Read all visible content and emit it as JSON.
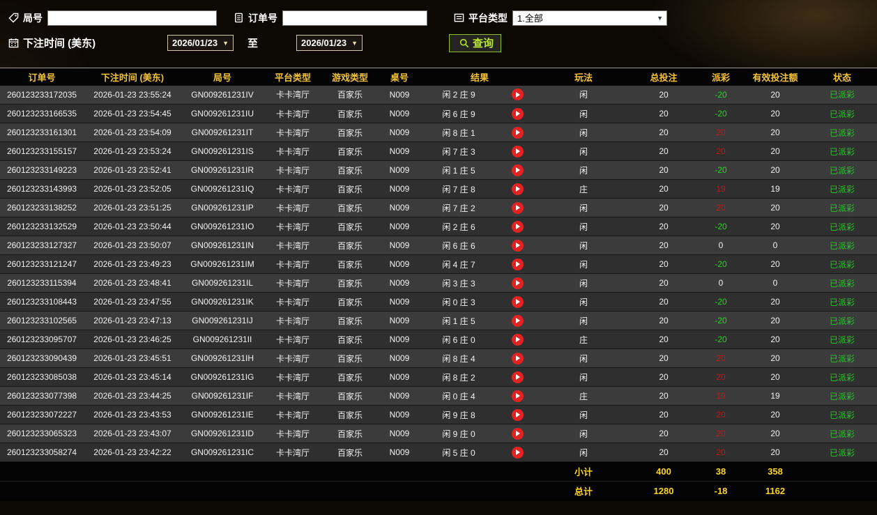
{
  "toolbar": {
    "round_label": "局号",
    "round_value": "",
    "order_label": "订单号",
    "order_value": "",
    "platform_label": "平台类型",
    "platform_value": "1.全部",
    "bet_time_label": "下注时间 (美东)",
    "date_from": "2026/01/23",
    "to_label": "至",
    "date_to": "2026/01/23",
    "query_label": "查询"
  },
  "colors": {
    "header_text": "#f2c23a",
    "win_red": "#c01818",
    "loss_green": "#27d527",
    "status_green": "#2fc32f",
    "footer_yellow": "#ffd41c",
    "query_accent": "#b9e62e",
    "play_button_red": "#e32222"
  },
  "table": {
    "headers": [
      "订单号",
      "下注时间 (美东)",
      "局号",
      "平台类型",
      "游戏类型",
      "桌号",
      "结果",
      "玩法",
      "总投注",
      "派彩",
      "有效投注额",
      "状态"
    ],
    "rows": [
      {
        "order_id": "260123233172035",
        "bet_time": "2026-01-23 23:55:24",
        "round_id": "GN009261231IV",
        "platform": "卡卡湾厅",
        "game_type": "百家乐",
        "table_no": "N009",
        "result": "闲 2 庄 9",
        "play_type": "闲",
        "total_bet": "20",
        "payout": "-20",
        "valid_bet": "20",
        "status": "已派彩"
      },
      {
        "order_id": "260123233166535",
        "bet_time": "2026-01-23 23:54:45",
        "round_id": "GN009261231IU",
        "platform": "卡卡湾厅",
        "game_type": "百家乐",
        "table_no": "N009",
        "result": "闲 6 庄 9",
        "play_type": "闲",
        "total_bet": "20",
        "payout": "-20",
        "valid_bet": "20",
        "status": "已派彩"
      },
      {
        "order_id": "260123233161301",
        "bet_time": "2026-01-23 23:54:09",
        "round_id": "GN009261231IT",
        "platform": "卡卡湾厅",
        "game_type": "百家乐",
        "table_no": "N009",
        "result": "闲 8 庄 1",
        "play_type": "闲",
        "total_bet": "20",
        "payout": "20",
        "valid_bet": "20",
        "status": "已派彩"
      },
      {
        "order_id": "260123233155157",
        "bet_time": "2026-01-23 23:53:24",
        "round_id": "GN009261231IS",
        "platform": "卡卡湾厅",
        "game_type": "百家乐",
        "table_no": "N009",
        "result": "闲 7 庄 3",
        "play_type": "闲",
        "total_bet": "20",
        "payout": "20",
        "valid_bet": "20",
        "status": "已派彩"
      },
      {
        "order_id": "260123233149223",
        "bet_time": "2026-01-23 23:52:41",
        "round_id": "GN009261231IR",
        "platform": "卡卡湾厅",
        "game_type": "百家乐",
        "table_no": "N009",
        "result": "闲 1 庄 5",
        "play_type": "闲",
        "total_bet": "20",
        "payout": "-20",
        "valid_bet": "20",
        "status": "已派彩"
      },
      {
        "order_id": "260123233143993",
        "bet_time": "2026-01-23 23:52:05",
        "round_id": "GN009261231IQ",
        "platform": "卡卡湾厅",
        "game_type": "百家乐",
        "table_no": "N009",
        "result": "闲 7 庄 8",
        "play_type": "庄",
        "total_bet": "20",
        "payout": "19",
        "valid_bet": "19",
        "status": "已派彩"
      },
      {
        "order_id": "260123233138252",
        "bet_time": "2026-01-23 23:51:25",
        "round_id": "GN009261231IP",
        "platform": "卡卡湾厅",
        "game_type": "百家乐",
        "table_no": "N009",
        "result": "闲 7 庄 2",
        "play_type": "闲",
        "total_bet": "20",
        "payout": "20",
        "valid_bet": "20",
        "status": "已派彩"
      },
      {
        "order_id": "260123233132529",
        "bet_time": "2026-01-23 23:50:44",
        "round_id": "GN009261231IO",
        "platform": "卡卡湾厅",
        "game_type": "百家乐",
        "table_no": "N009",
        "result": "闲 2 庄 6",
        "play_type": "闲",
        "total_bet": "20",
        "payout": "-20",
        "valid_bet": "20",
        "status": "已派彩"
      },
      {
        "order_id": "260123233127327",
        "bet_time": "2026-01-23 23:50:07",
        "round_id": "GN009261231IN",
        "platform": "卡卡湾厅",
        "game_type": "百家乐",
        "table_no": "N009",
        "result": "闲 6 庄 6",
        "play_type": "闲",
        "total_bet": "20",
        "payout": "0",
        "valid_bet": "0",
        "status": "已派彩"
      },
      {
        "order_id": "260123233121247",
        "bet_time": "2026-01-23 23:49:23",
        "round_id": "GN009261231IM",
        "platform": "卡卡湾厅",
        "game_type": "百家乐",
        "table_no": "N009",
        "result": "闲 4 庄 7",
        "play_type": "闲",
        "total_bet": "20",
        "payout": "-20",
        "valid_bet": "20",
        "status": "已派彩"
      },
      {
        "order_id": "260123233115394",
        "bet_time": "2026-01-23 23:48:41",
        "round_id": "GN009261231IL",
        "platform": "卡卡湾厅",
        "game_type": "百家乐",
        "table_no": "N009",
        "result": "闲 3 庄 3",
        "play_type": "闲",
        "total_bet": "20",
        "payout": "0",
        "valid_bet": "0",
        "status": "已派彩"
      },
      {
        "order_id": "260123233108443",
        "bet_time": "2026-01-23 23:47:55",
        "round_id": "GN009261231IK",
        "platform": "卡卡湾厅",
        "game_type": "百家乐",
        "table_no": "N009",
        "result": "闲 0 庄 3",
        "play_type": "闲",
        "total_bet": "20",
        "payout": "-20",
        "valid_bet": "20",
        "status": "已派彩"
      },
      {
        "order_id": "260123233102565",
        "bet_time": "2026-01-23 23:47:13",
        "round_id": "GN009261231IJ",
        "platform": "卡卡湾厅",
        "game_type": "百家乐",
        "table_no": "N009",
        "result": "闲 1 庄 5",
        "play_type": "闲",
        "total_bet": "20",
        "payout": "-20",
        "valid_bet": "20",
        "status": "已派彩"
      },
      {
        "order_id": "260123233095707",
        "bet_time": "2026-01-23 23:46:25",
        "round_id": "GN009261231II",
        "platform": "卡卡湾厅",
        "game_type": "百家乐",
        "table_no": "N009",
        "result": "闲 6 庄 0",
        "play_type": "庄",
        "total_bet": "20",
        "payout": "-20",
        "valid_bet": "20",
        "status": "已派彩"
      },
      {
        "order_id": "260123233090439",
        "bet_time": "2026-01-23 23:45:51",
        "round_id": "GN009261231IH",
        "platform": "卡卡湾厅",
        "game_type": "百家乐",
        "table_no": "N009",
        "result": "闲 8 庄 4",
        "play_type": "闲",
        "total_bet": "20",
        "payout": "20",
        "valid_bet": "20",
        "status": "已派彩"
      },
      {
        "order_id": "260123233085038",
        "bet_time": "2026-01-23 23:45:14",
        "round_id": "GN009261231IG",
        "platform": "卡卡湾厅",
        "game_type": "百家乐",
        "table_no": "N009",
        "result": "闲 8 庄 2",
        "play_type": "闲",
        "total_bet": "20",
        "payout": "20",
        "valid_bet": "20",
        "status": "已派彩"
      },
      {
        "order_id": "260123233077398",
        "bet_time": "2026-01-23 23:44:25",
        "round_id": "GN009261231IF",
        "platform": "卡卡湾厅",
        "game_type": "百家乐",
        "table_no": "N009",
        "result": "闲 0 庄 4",
        "play_type": "庄",
        "total_bet": "20",
        "payout": "19",
        "valid_bet": "19",
        "status": "已派彩"
      },
      {
        "order_id": "260123233072227",
        "bet_time": "2026-01-23 23:43:53",
        "round_id": "GN009261231IE",
        "platform": "卡卡湾厅",
        "game_type": "百家乐",
        "table_no": "N009",
        "result": "闲 9 庄 8",
        "play_type": "闲",
        "total_bet": "20",
        "payout": "20",
        "valid_bet": "20",
        "status": "已派彩"
      },
      {
        "order_id": "260123233065323",
        "bet_time": "2026-01-23 23:43:07",
        "round_id": "GN009261231ID",
        "platform": "卡卡湾厅",
        "game_type": "百家乐",
        "table_no": "N009",
        "result": "闲 9 庄 0",
        "play_type": "闲",
        "total_bet": "20",
        "payout": "20",
        "valid_bet": "20",
        "status": "已派彩"
      },
      {
        "order_id": "260123233058274",
        "bet_time": "2026-01-23 23:42:22",
        "round_id": "GN009261231IC",
        "platform": "卡卡湾厅",
        "game_type": "百家乐",
        "table_no": "N009",
        "result": "闲 5 庄 0",
        "play_type": "闲",
        "total_bet": "20",
        "payout": "20",
        "valid_bet": "20",
        "status": "已派彩"
      }
    ],
    "footer": [
      {
        "label": "小计",
        "total_bet": "400",
        "payout": "38",
        "valid_bet": "358"
      },
      {
        "label": "总计",
        "total_bet": "1280",
        "payout": "-18",
        "valid_bet": "1162"
      }
    ]
  }
}
